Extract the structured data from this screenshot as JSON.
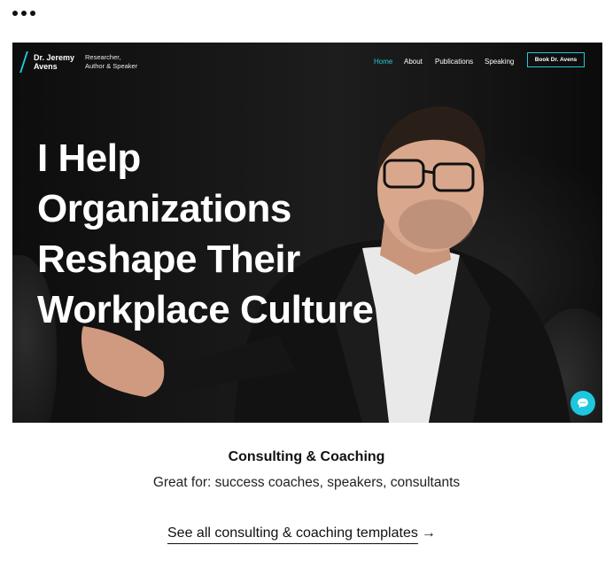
{
  "window": {
    "menu_icon": "more-horizontal-icon"
  },
  "site": {
    "brand_name": "Dr. Jeremy Avens",
    "brand_tagline": "Researcher, Author & Speaker",
    "accent": "#28c8d8",
    "nav": [
      {
        "label": "Home",
        "active": true
      },
      {
        "label": "About"
      },
      {
        "label": "Publications"
      },
      {
        "label": "Speaking"
      }
    ],
    "cta_button": "Book Dr. Avens",
    "headline": [
      "I Help",
      "Organizations",
      "Reshape Their",
      "Workplace Culture"
    ],
    "chat_icon": "chat-bubble-icon"
  },
  "template": {
    "title": "Consulting & Coaching",
    "subtitle": "Great for: success coaches, speakers, consultants",
    "link_label": "See all consulting & coaching templates",
    "link_arrow": "→"
  }
}
